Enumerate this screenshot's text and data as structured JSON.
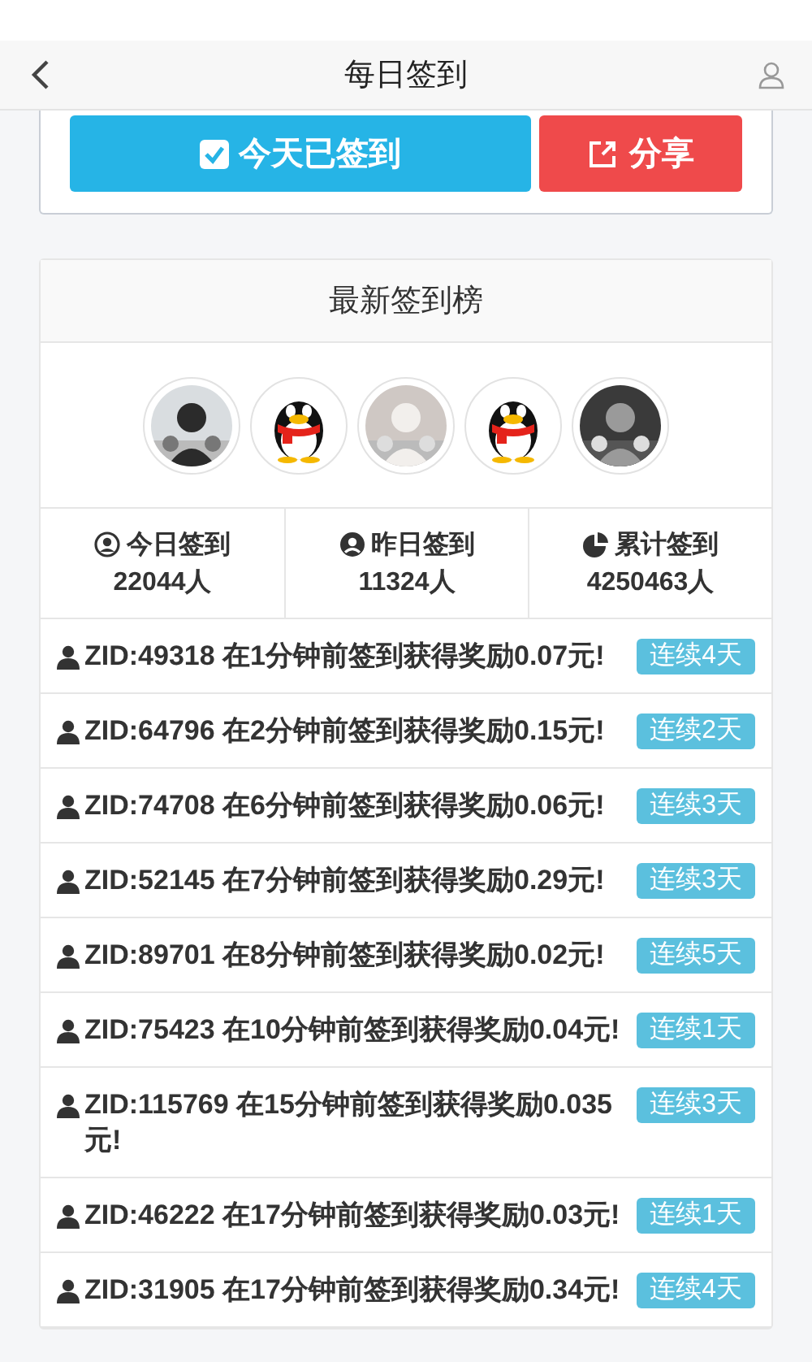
{
  "header": {
    "title": "每日签到"
  },
  "actions": [
    {
      "kind": "checkin",
      "label": "今天已签到"
    },
    {
      "kind": "share",
      "label": "分享"
    }
  ],
  "leaderboard": {
    "title": "最新签到榜",
    "avatars": [
      {
        "kind": "picture"
      },
      {
        "kind": "penguin"
      },
      {
        "kind": "picture"
      },
      {
        "kind": "penguin"
      },
      {
        "kind": "picture"
      }
    ],
    "stats": [
      {
        "kind": "today",
        "label": "今日签到",
        "value": "22044人"
      },
      {
        "kind": "yesterday",
        "label": "昨日签到",
        "value": "11324人"
      },
      {
        "kind": "total",
        "label": "累计签到",
        "value": "4250463人"
      }
    ],
    "records": [
      {
        "text": "ZID:49318 在1分钟前签到获得奖励0.07元!",
        "badge": "连续4天"
      },
      {
        "text": "ZID:64796 在2分钟前签到获得奖励0.15元!",
        "badge": "连续2天"
      },
      {
        "text": "ZID:74708 在6分钟前签到获得奖励0.06元!",
        "badge": "连续3天"
      },
      {
        "text": "ZID:52145 在7分钟前签到获得奖励0.29元!",
        "badge": "连续3天"
      },
      {
        "text": "ZID:89701 在8分钟前签到获得奖励0.02元!",
        "badge": "连续5天"
      },
      {
        "text": "ZID:75423 在10分钟前签到获得奖励0.04元!",
        "badge": "连续1天"
      },
      {
        "text": "ZID:115769 在15分钟前签到获得奖励0.035元!",
        "badge": "连续3天"
      },
      {
        "text": "ZID:46222 在17分钟前签到获得奖励0.03元!",
        "badge": "连续1天"
      },
      {
        "text": "ZID:31905 在17分钟前签到获得奖励0.34元!",
        "badge": "连续4天"
      }
    ]
  }
}
